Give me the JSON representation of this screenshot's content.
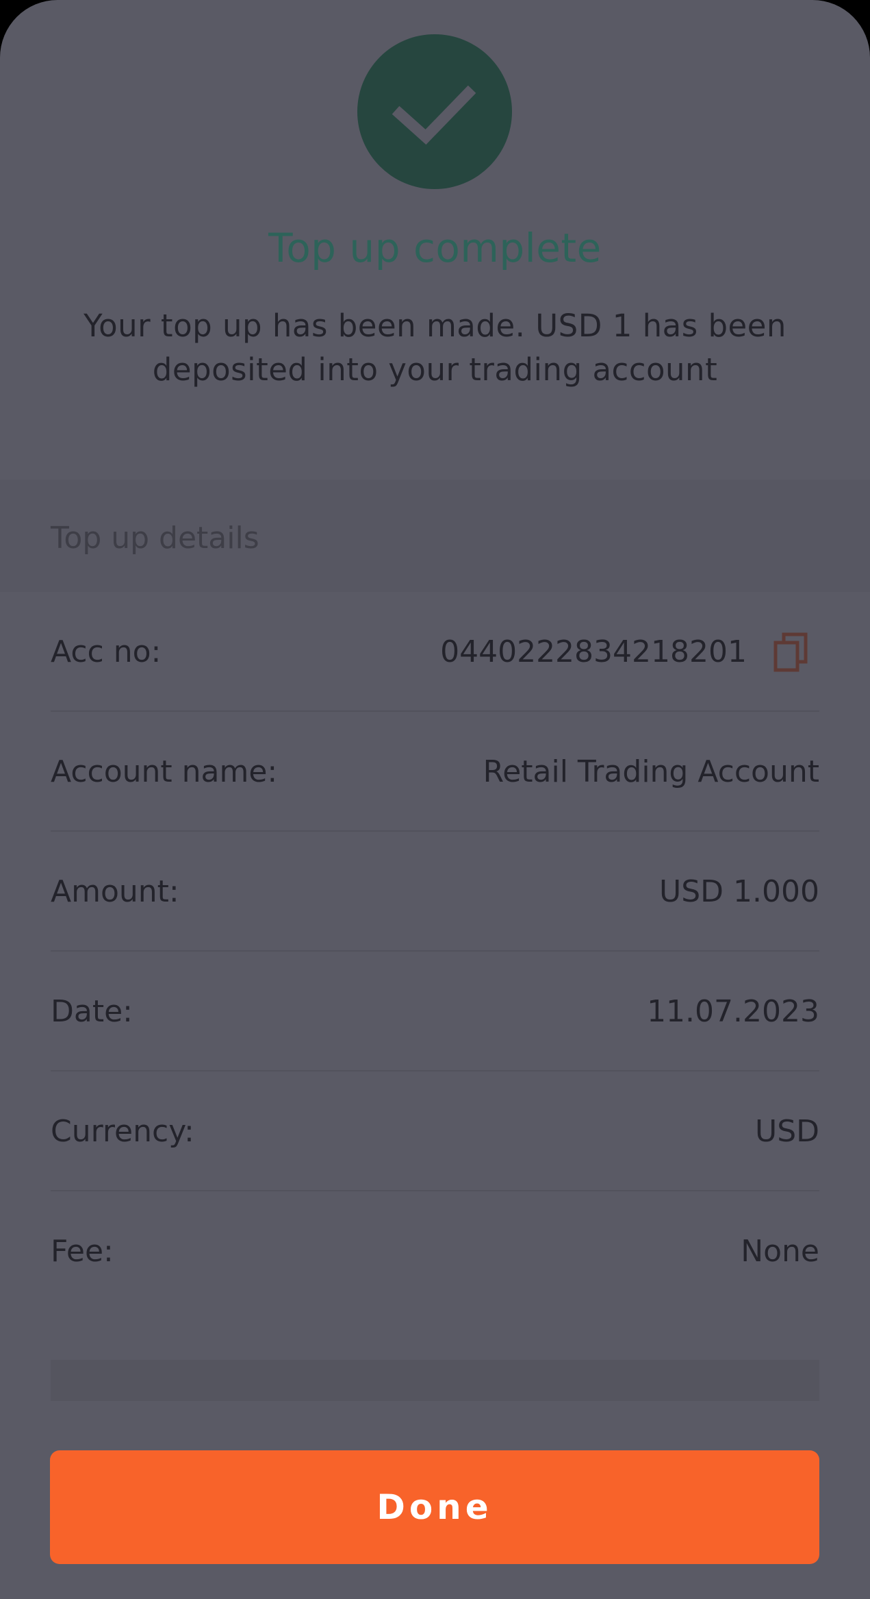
{
  "status": {
    "icon": "checkmark-icon",
    "title": "Top up complete",
    "message": "Your top up has been made. USD 1 has been deposited into your trading account"
  },
  "details": {
    "header": "Top up details",
    "rows": [
      {
        "label": "Acc no:",
        "value": "0440222834218201"
      },
      {
        "label": "Account name:",
        "value": "Retail Trading Account"
      },
      {
        "label": "Amount:",
        "value": "USD 1.000"
      },
      {
        "label": "Date:",
        "value": "11.07.2023"
      },
      {
        "label": "Currency:",
        "value": "USD"
      },
      {
        "label": "Fee:",
        "value": "None"
      }
    ]
  },
  "done_label": "Done",
  "colors": {
    "accent": "#f8632a",
    "success": "#26463f",
    "background": "#5a5a65"
  }
}
